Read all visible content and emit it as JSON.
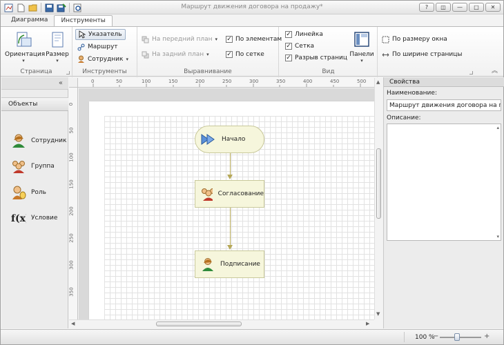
{
  "window": {
    "title": "Маршрут движения договора на продажу*"
  },
  "tabs": [
    {
      "label": "Диаграмма"
    },
    {
      "label": "Инструменты"
    }
  ],
  "ribbon": {
    "page_group": {
      "label": "Страница",
      "orientation": "Ориентация",
      "size": "Размер"
    },
    "tools_group": {
      "label": "Инструменты",
      "pointer": "Указатель",
      "route": "Маршрут",
      "employee": "Сотрудник"
    },
    "align_group": {
      "label": "Выравнивание",
      "bring_front": "На передний план",
      "send_back": "На задний план",
      "by_elements": "По элементам",
      "by_grid": "По сетке"
    },
    "view_group": {
      "label": "Вид",
      "ruler": "Линейка",
      "grid": "Сетка",
      "page_break": "Разрыв страниц",
      "panels": "Панели",
      "fit_window": "По размеру окна",
      "fit_width": "По ширине страницы"
    }
  },
  "left_panel": {
    "section": "Объекты",
    "items": [
      {
        "label": "Сотрудник"
      },
      {
        "label": "Группа"
      },
      {
        "label": "Роль"
      },
      {
        "label": "Условие"
      }
    ]
  },
  "ruler": {
    "h_ticks": [
      "0",
      "50",
      "100",
      "150",
      "200",
      "250",
      "300",
      "350",
      "400",
      "450",
      "500"
    ],
    "v_ticks": [
      "0",
      "50",
      "100",
      "150",
      "200",
      "250",
      "300",
      "350"
    ]
  },
  "diagram": {
    "nodes": [
      {
        "label": "Начало"
      },
      {
        "label": "Согласование"
      },
      {
        "label": "Подписание"
      }
    ]
  },
  "properties": {
    "title": "Свойства",
    "name_label": "Наименование:",
    "name_value": "Маршрут движения договора на продажу",
    "desc_label": "Описание:"
  },
  "status": {
    "zoom": "100 %"
  }
}
